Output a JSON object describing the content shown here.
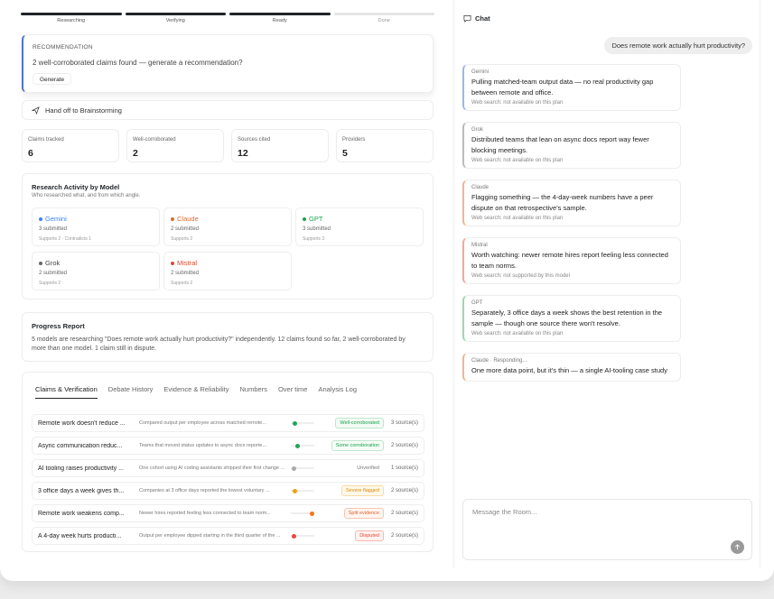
{
  "stepper": [
    "Researching",
    "Verifying",
    "Ready",
    "Done"
  ],
  "recommendation": {
    "kicker": "RECOMMENDATION",
    "message": "2 well-corroborated claims found — generate a recommendation?",
    "button": "Generate"
  },
  "handoff": "Hand off to Brainstorming",
  "stats": [
    {
      "label": "Claims tracked",
      "value": "6"
    },
    {
      "label": "Well-corroborated",
      "value": "2"
    },
    {
      "label": "Sources cited",
      "value": "12"
    },
    {
      "label": "Providers",
      "value": "5"
    }
  ],
  "activity": {
    "title": "Research Activity by Model",
    "subtitle": "Who researched what, and from which angle.",
    "models": [
      {
        "name": "Gemini",
        "submitted": "3 submitted",
        "meta": "Supports 2 · Contradicts 1",
        "color": "#3b82f6"
      },
      {
        "name": "Claude",
        "submitted": "2 submitted",
        "meta": "Supports 2",
        "color": "#e06b2f"
      },
      {
        "name": "GPT",
        "submitted": "3 submitted",
        "meta": "Supports 3",
        "color": "#16a34a"
      },
      {
        "name": "Grok",
        "submitted": "2 submitted",
        "meta": "Supports 2",
        "color": "#666666"
      },
      {
        "name": "Mistral",
        "submitted": "2 submitted",
        "meta": "Supports 2",
        "color": "#e0482f"
      }
    ]
  },
  "progress": {
    "title": "Progress Report",
    "text": "5 models are researching \"Does remote work actually hurt productivity?\" independently. 12 claims found so far, 2 well-corroborated by more than one model. 1 claim still in dispute."
  },
  "tabs": [
    "Claims & Verification",
    "Debate History",
    "Evidence & Reliability",
    "Numbers",
    "Over time",
    "Analysis Log"
  ],
  "claims": [
    {
      "title": "Remote work doesn't reduce ...",
      "desc": "Compared output per employee across matched remote...",
      "badge": "Well-corroborated",
      "badgeType": "good",
      "sources": "3 source(s)",
      "level": 0.1,
      "dot": "#22a55a"
    },
    {
      "title": "Async communication reduc...",
      "desc": "Teams that moved status updates to async docs reporte...",
      "badge": "Some corroboration",
      "badgeType": "some",
      "sources": "2 source(s)",
      "level": 0.25,
      "dot": "#22a55a"
    },
    {
      "title": "AI tooling raises productivity ...",
      "desc": "One cohort using AI coding assistants shipped their first change ...",
      "badge": "Unverified",
      "badgeType": "none",
      "sources": "1 source(s)",
      "level": 0.05,
      "dot": "#aaaaaa"
    },
    {
      "title": "3 office days a week gives th...",
      "desc": "Companies at 3 office days reported the lowest voluntary ...",
      "badge": "Severe flagged",
      "badgeType": "warn",
      "sources": "2 source(s)",
      "level": 0.1,
      "dot": "#f59e0b"
    },
    {
      "title": "Remote work weakens comp...",
      "desc": "Newer hires reported feeling less connected to team norm...",
      "badge": "Split evidence",
      "badgeType": "split",
      "sources": "2 source(s)",
      "level": 1.0,
      "dot": "#f97316"
    },
    {
      "title": "A 4-day week hurts producti...",
      "desc": "Output per employee dipped starting in the third quarter of the ...",
      "badge": "Disputed",
      "badgeType": "bad",
      "sources": "2 source(s)",
      "level": 0.05,
      "dot": "#ef4444"
    }
  ],
  "chat": {
    "title": "Chat",
    "user": "Does remote work actually hurt productivity?",
    "messages": [
      {
        "who": "Gemini",
        "text": "Pulling matched-team output data — no real productivity gap between remote and office.",
        "ws": "Web search: not available on this plan",
        "accent": "#9fb7e6"
      },
      {
        "who": "Grok",
        "text": "Distributed teams that lean on async docs report way fewer blocking meetings.",
        "ws": "Web search: not available on this plan",
        "accent": "#bbbbbb"
      },
      {
        "who": "Claude",
        "text": "Flagging something — the 4-day-week numbers have a peer dispute on that retrospective's sample.",
        "ws": "Web search: not available on this plan",
        "accent": "#f0b596"
      },
      {
        "who": "Mistral",
        "text": "Worth watching: newer remote hires report feeling less connected to team norms.",
        "ws": "Web search: not supported by this model",
        "accent": "#f3a79a"
      },
      {
        "who": "GPT",
        "text": "Separately, 3 office days a week shows the best retention in the sample — though one source there won't resolve.",
        "ws": "Web search: not available on this plan",
        "accent": "#9fd6b0"
      },
      {
        "who": "Claude · Responding...",
        "text": "One more data point, but it's thin — a single AI-tooling case study",
        "ws": "",
        "accent": "#f0b596"
      }
    ],
    "placeholder": "Message the Room..."
  }
}
